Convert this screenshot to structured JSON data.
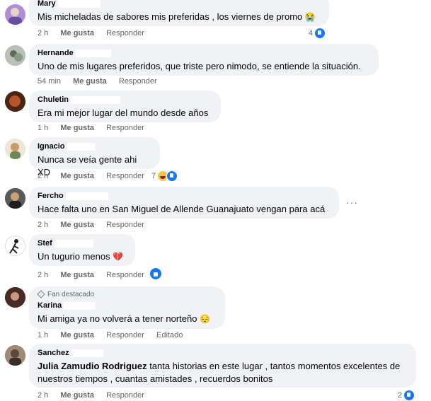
{
  "comments": [
    {
      "name": "Mary",
      "text": "Mis micheladas de sabores mis preferidas , los viernes de promo",
      "emoji": "😭",
      "time": "2 h",
      "like_label": "Me gusta",
      "reply_label": "Responder",
      "reaction_count": "4",
      "avatar_color": "#b08dd6"
    },
    {
      "name": "Hernande",
      "text": "Uno de mis lugares preferidos, que triste pero nimodo, se entiende la situación.",
      "time": "54 min",
      "like_label": "Me gusta",
      "reply_label": "Responder",
      "avatar_color": "#9aa29c"
    },
    {
      "name": "Chuletin",
      "text": "Era mi mejor lugar del mundo desde años",
      "time": "1 h",
      "like_label": "Me gusta",
      "reply_label": "Responder",
      "avatar_color": "#7a3b22"
    },
    {
      "name": "Ignacio",
      "text": "Nunca se veía gente ahi XD",
      "time": "2 h",
      "like_label": "Me gusta",
      "reply_label": "Responder",
      "reaction_count": "7",
      "avatar_color": "#d9c8a8"
    },
    {
      "name": "Fercho",
      "text": "Hace falta uno en San Miguel de Allende Guanajuato vengan para acá",
      "time": "2 h",
      "like_label": "Me gusta",
      "reply_label": "Responder",
      "more_label": "···",
      "avatar_color": "#3b3a3a"
    },
    {
      "name": "Stef",
      "text": "Un tugurio menos",
      "emoji": "💔",
      "time": "2 h",
      "like_label": "Me gusta",
      "reply_label": "Responder",
      "avatar_color": "#2a2a2a"
    },
    {
      "badge": "Fan destacado",
      "name": "Karina",
      "text": "Mi amiga ya no volverá a tener norteño",
      "emoji": "😔",
      "time": "1 h",
      "like_label": "Me gusta",
      "reply_label": "Responder",
      "edited_label": "Editado",
      "avatar_color": "#5b3a33"
    },
    {
      "name": "Sanchez",
      "mention": "Julia Zamudio Rodriguez",
      "text": " tanta historias en este lugar , tantos momentos excelentes de nuestros tiempos , cuantas amistades , recuerdos bonitos",
      "time": "2 h",
      "like_label": "Me gusta",
      "reply_label": "Responder",
      "reaction_count": "2",
      "avatar_color": "#7d6a5a"
    }
  ]
}
